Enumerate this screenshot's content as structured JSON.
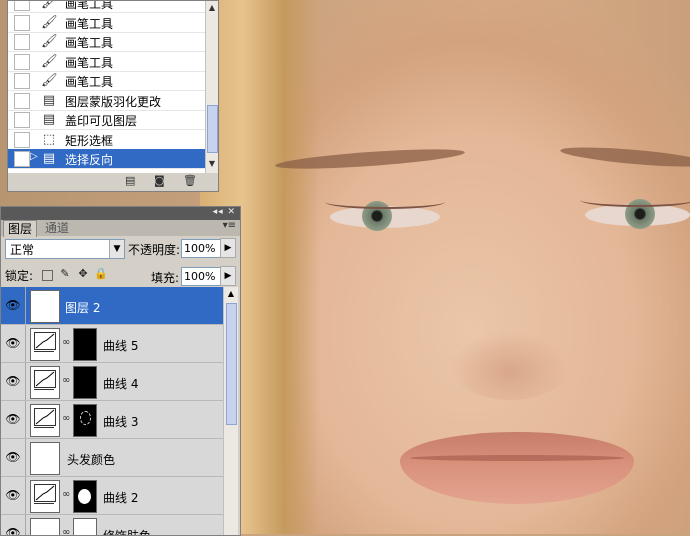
{
  "history": {
    "items": [
      {
        "label": "画笔工具",
        "icon": "brush-icon"
      },
      {
        "label": "画笔工具",
        "icon": "brush-icon"
      },
      {
        "label": "画笔工具",
        "icon": "brush-icon"
      },
      {
        "label": "画笔工具",
        "icon": "brush-icon"
      },
      {
        "label": "画笔工具",
        "icon": "brush-icon"
      },
      {
        "label": "图层蒙版羽化更改",
        "icon": "document-icon"
      },
      {
        "label": "盖印可见图层",
        "icon": "document-icon"
      },
      {
        "label": "矩形选框",
        "icon": "marquee-icon"
      },
      {
        "label": "选择反向",
        "icon": "document-icon",
        "selected": true
      }
    ]
  },
  "layers_panel": {
    "tabs": [
      "图层",
      "通道"
    ],
    "blend_mode": "正常",
    "opacity_label": "不透明度:",
    "opacity_value": "100%",
    "lock_label": "锁定:",
    "fill_label": "填充:",
    "fill_value": "100%",
    "layers": [
      {
        "name": "图层 2",
        "type": "pixel",
        "selected": true
      },
      {
        "name": "曲线 5",
        "type": "curves"
      },
      {
        "name": "曲线 4",
        "type": "curves"
      },
      {
        "name": "曲线 3",
        "type": "curves"
      },
      {
        "name": "头发颜色",
        "type": "fill"
      },
      {
        "name": "曲线 2",
        "type": "curves"
      },
      {
        "name": "修饰肤色",
        "type": "fill-mask"
      }
    ]
  },
  "colors": {
    "selection": "#316ac5",
    "panel_bg": "#d4d0c8"
  }
}
